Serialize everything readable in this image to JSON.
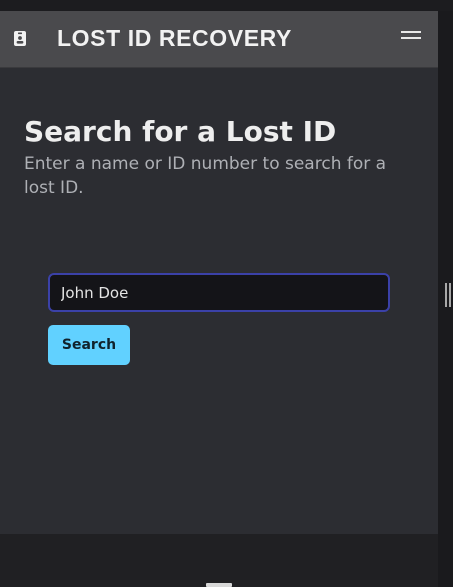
{
  "navbar": {
    "title": "LOST ID RECOVERY",
    "brand_icon": "id-badge-icon",
    "menu_icon": "hamburger-menu-icon"
  },
  "main": {
    "title": "Search for a Lost ID",
    "subtitle": "Enter a name or ID number to search for a lost ID."
  },
  "search": {
    "value": "John Doe",
    "button_label": "Search"
  },
  "colors": {
    "navbar_bg": "#4a4a4d",
    "page_bg": "#2c2d32",
    "input_border": "#3b41a8",
    "button_bg": "#61d1ff",
    "footer_bg": "#202023"
  }
}
